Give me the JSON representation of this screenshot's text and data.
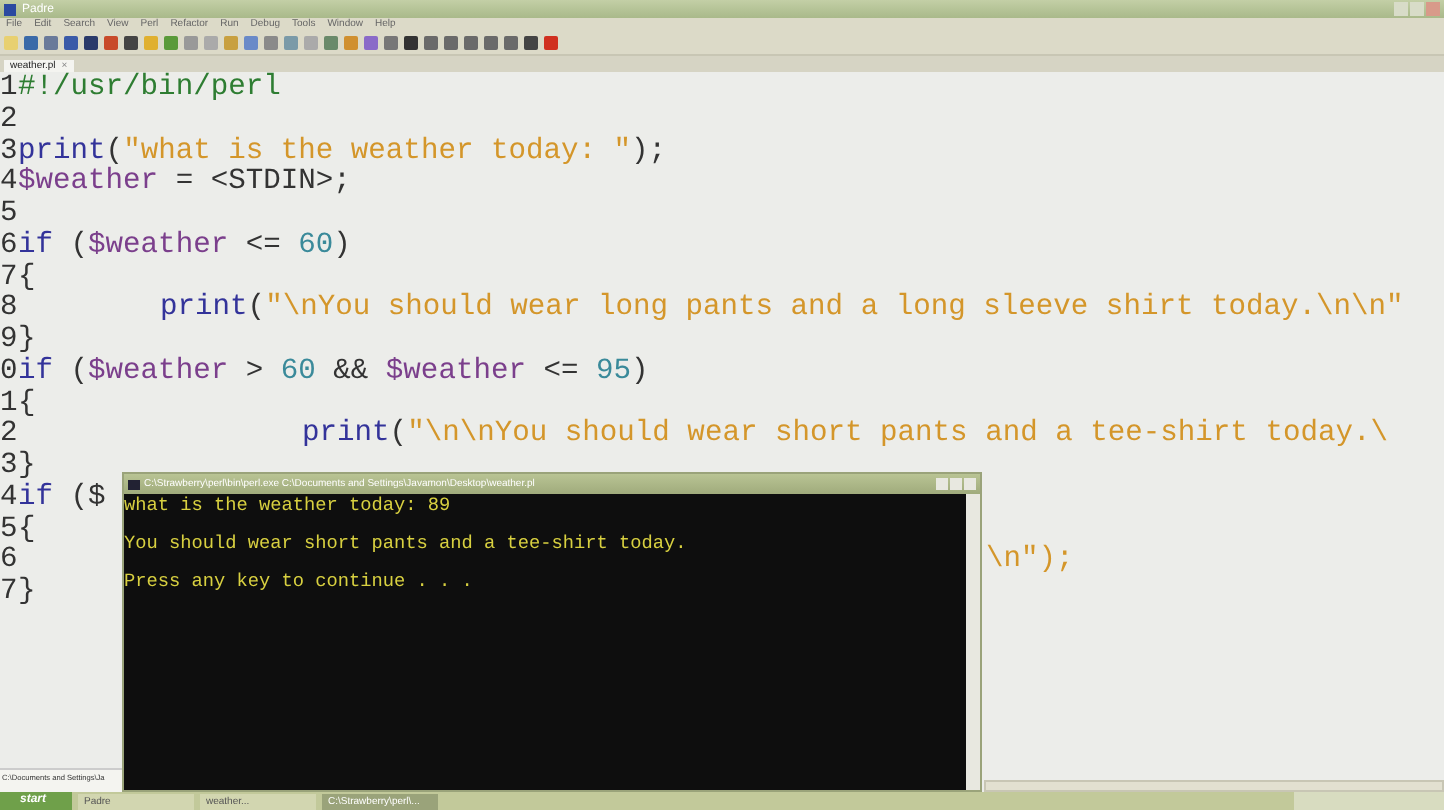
{
  "window": {
    "title": "Padre"
  },
  "menu": [
    "File",
    "Edit",
    "Search",
    "View",
    "Perl",
    "Refactor",
    "Run",
    "Debug",
    "Tools",
    "Window",
    "Help"
  ],
  "tabs": [
    {
      "label": "weather.pl",
      "selected": true,
      "close": "×"
    }
  ],
  "side_panel": {
    "text": "C:\\Documents and Settings\\Ja"
  },
  "editor": {
    "lines": [
      {
        "number": "1",
        "tokens": [
          {
            "kind": "comment",
            "text": "#!/usr/bin/perl"
          }
        ]
      },
      {
        "number": "2"
      },
      {
        "number": "3",
        "tokens": [
          {
            "kind": "keyword",
            "text": "print"
          },
          {
            "kind": "punct",
            "text": "("
          },
          {
            "kind": "string",
            "text": "\"what is the weather today: \""
          },
          {
            "kind": "punct",
            "text": ");"
          }
        ]
      },
      {
        "number": "4",
        "tokens": [
          {
            "kind": "variable",
            "text": "$weather"
          },
          {
            "kind": "punct",
            "text": " = <STDIN>;"
          }
        ]
      },
      {
        "number": "5"
      },
      {
        "number": "6",
        "tokens": [
          {
            "kind": "keyword",
            "text": "if"
          },
          {
            "kind": "punct",
            "text": " ("
          },
          {
            "kind": "variable",
            "text": "$weather"
          },
          {
            "kind": "punct",
            "text": " <= "
          },
          {
            "kind": "number",
            "text": "60"
          },
          {
            "kind": "punct",
            "text": ")"
          }
        ]
      },
      {
        "number": "7",
        "tokens": [
          {
            "kind": "punct",
            "text": "{"
          }
        ]
      },
      {
        "number": "8",
        "kind": "indent",
        "tokens": [
          {
            "kind": "keyword",
            "text": "print"
          },
          {
            "kind": "punct",
            "text": "("
          },
          {
            "kind": "string",
            "text": "\"\\nYou should wear long pants and a long sleeve shirt today.\\n\\n\""
          }
        ]
      },
      {
        "number": "9",
        "tokens": [
          {
            "kind": "punct",
            "text": "}"
          }
        ]
      },
      {
        "number": "0",
        "tokens": [
          {
            "kind": "keyword",
            "text": "if"
          },
          {
            "kind": "punct",
            "text": " ("
          },
          {
            "kind": "variable",
            "text": "$weather"
          },
          {
            "kind": "punct",
            "text": " > "
          },
          {
            "kind": "number",
            "text": "60"
          },
          {
            "kind": "punct",
            "text": " && "
          },
          {
            "kind": "variable",
            "text": "$weather"
          },
          {
            "kind": "punct",
            "text": " <= "
          },
          {
            "kind": "number",
            "text": "95"
          },
          {
            "kind": "punct",
            "text": ")"
          }
        ]
      },
      {
        "number": "1",
        "tokens": [
          {
            "kind": "punct",
            "text": "{"
          }
        ]
      },
      {
        "number": "2",
        "kind": "deep_indent",
        "tokens": [
          {
            "kind": "keyword",
            "text": "print"
          },
          {
            "kind": "punct",
            "text": "("
          },
          {
            "kind": "string",
            "text": "\"\\n\\nYou should wear short pants and a tee-shirt today.\\"
          }
        ]
      },
      {
        "number": "3",
        "tokens": [
          {
            "kind": "punct",
            "text": "}"
          }
        ]
      },
      {
        "number": "4",
        "tokens": [
          {
            "kind": "keyword",
            "text": "if"
          },
          {
            "kind": "punct",
            "text": " ($"
          }
        ]
      },
      {
        "number": "5",
        "tokens": [
          {
            "kind": "punct",
            "text": "{"
          }
        ]
      },
      {
        "number": "6",
        "tokens": [
          {
            "kind": "tail",
            "text": "\\n\");"
          }
        ]
      },
      {
        "number": "7",
        "tokens": [
          {
            "kind": "punct",
            "text": "}"
          }
        ]
      }
    ]
  },
  "console": {
    "title": "C:\\Strawberry\\perl\\bin\\perl.exe  C:\\Documents and Settings\\Javamon\\Desktop\\weather.pl",
    "lines": [
      {
        "text": "what is the weather today: 89",
        "gap_before": false
      },
      {
        "text": "You should wear short pants and a tee-shirt today.",
        "gap_before": true
      },
      {
        "text": "Press any key to continue . . .",
        "gap_before": true
      }
    ]
  },
  "taskbar": {
    "start": "start",
    "items": [
      {
        "label": "Padre",
        "selected": false
      },
      {
        "label": "weather...",
        "selected": false
      },
      {
        "label": "C:\\Strawberry\\perl\\...",
        "selected": true
      }
    ]
  }
}
